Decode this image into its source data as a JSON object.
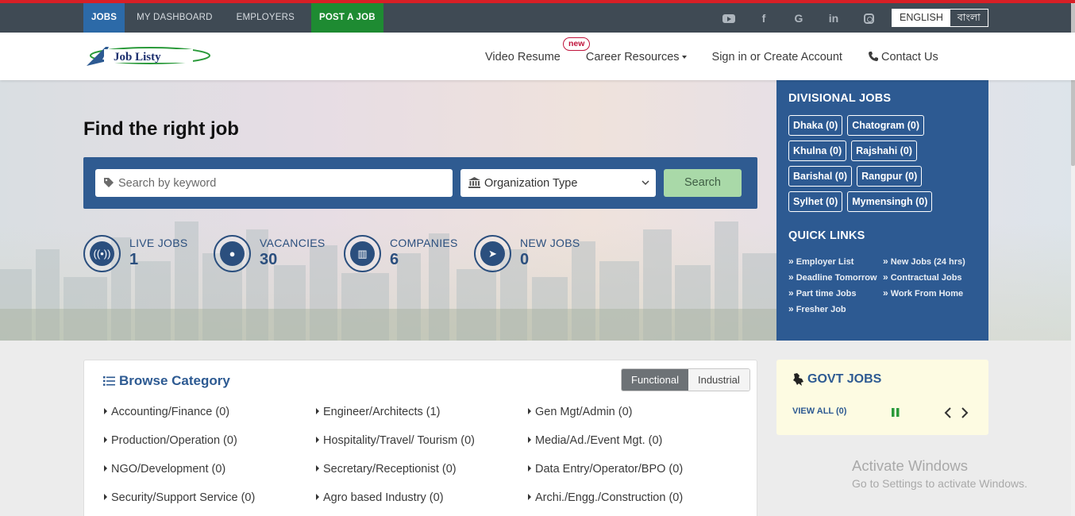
{
  "topbar": {
    "nav": [
      "JOBS",
      "MY DASHBOARD",
      "EMPLOYERS",
      "POST A JOB"
    ],
    "socials": [
      "youtube-icon",
      "facebook-icon",
      "google-icon",
      "linkedin-icon",
      "instagram-icon"
    ],
    "lang_english": "ENGLISH",
    "lang_bangla": "বাংলা"
  },
  "header": {
    "logo_text": "Job Listy",
    "video_resume": "Video Resume",
    "badge_new": "new",
    "career_resources": "Career Resources",
    "sign_in": "Sign in or Create Account",
    "contact": "Contact Us"
  },
  "hero": {
    "title": "Find the right job",
    "search_placeholder": "Search by keyword",
    "org_type": "Organization Type",
    "search_button": "Search",
    "stats": [
      {
        "label": "LIVE JOBS",
        "value": "1",
        "icon": "antenna-icon"
      },
      {
        "label": "VACANCIES",
        "value": "30",
        "icon": "user-icon"
      },
      {
        "label": "COMPANIES",
        "value": "6",
        "icon": "building-icon"
      },
      {
        "label": "NEW JOBS",
        "value": "0",
        "icon": "cursor-icon"
      }
    ]
  },
  "sidepanel": {
    "divisional_title": "DIVISIONAL JOBS",
    "divisions": [
      "Dhaka (0)",
      "Chatogram (0)",
      "Khulna (0)",
      "Rajshahi (0)",
      "Barishal (0)",
      "Rangpur (0)",
      "Sylhet (0)",
      "Mymensingh (0)"
    ],
    "quicklinks_title": "QUICK LINKS",
    "quicklinks": [
      "Employer List",
      "New Jobs (24 hrs)",
      "Deadline Tomorrow",
      "Contractual Jobs",
      "Part time Jobs",
      "Work From Home",
      "Fresher Job"
    ]
  },
  "browse": {
    "title": "Browse Category",
    "toggle_functional": "Functional",
    "toggle_industrial": "Industrial",
    "categories": [
      "Accounting/Finance (0)",
      "Engineer/Architects (1)",
      "Gen Mgt/Admin (0)",
      "Production/Operation (0)",
      "Hospitality/Travel/ Tourism (0)",
      "Media/Ad./Event Mgt. (0)",
      "NGO/Development (0)",
      "Secretary/Receptionist (0)",
      "Data Entry/Operator/BPO (0)",
      "Security/Support Service (0)",
      "Agro based Industry (0)",
      "Archi./Engg./Construction (0)"
    ]
  },
  "govt": {
    "title": "GOVT JOBS",
    "view_all": "VIEW ALL (0)"
  },
  "watermark": {
    "line1": "Activate Windows",
    "line2": "Go to Settings to activate Windows."
  },
  "colors": {
    "primary_blue": "#2d5a92",
    "topbar": "#3f4a54",
    "post_job_green": "#1e8b32",
    "search_green": "#a9d9a8",
    "accent_red": "#d81f26"
  }
}
